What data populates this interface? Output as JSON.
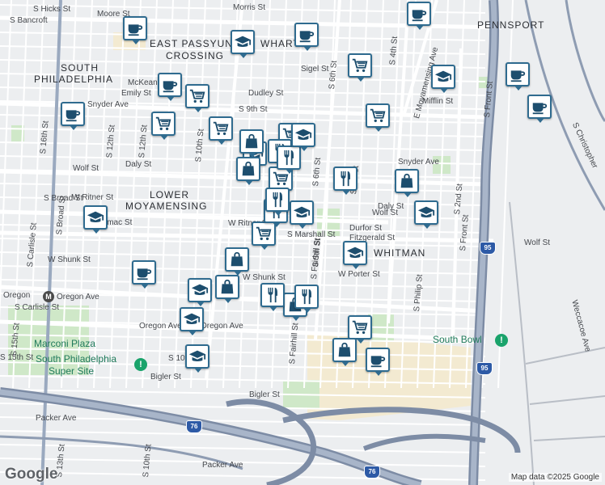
{
  "map": {
    "attribution": "Map data ©2025 Google",
    "logo": "Google",
    "area_labels": [
      "EAST PASSYUNK",
      "CROSSING",
      "SOUTH",
      "PHILADELPHIA",
      "LOWER",
      "MOYAMENSING",
      "WHITMAN",
      "PENNSPORT",
      "WHARTON"
    ],
    "poi_labels": [
      "Marconi Plaza",
      "South Philadelphia",
      "Super Site",
      "South Bowl",
      "Oregon"
    ],
    "streets": [
      "Morris St",
      "Moore St",
      "Sigel St",
      "McKean St",
      "Emily St",
      "Dudley St",
      "Snyder Ave",
      "Wolf St",
      "Daly St",
      "W Ritner St",
      "W Shunk St",
      "Oregon Ave",
      "W Porter St",
      "Bigler St",
      "Packer Ave",
      "Mifflin St",
      "Durfor St",
      "Fitzgerald St",
      "S 6th St",
      "S 4th St",
      "S 2nd St",
      "S Front St",
      "S 15th St",
      "S 16th St",
      "S Broad St",
      "S Carlisle St",
      "S 13th St",
      "S 12th St",
      "S 10th St",
      "S 9th St",
      "S 5th St",
      "S Philip St",
      "Weccacoe Ave",
      "E Moyamensing Ave",
      "S Christopher",
      "S Fairhill St",
      "S Marshall St",
      "S Camac St",
      "S Hicks St",
      "S Bancroft"
    ],
    "highway_shields": [
      "95",
      "76"
    ],
    "marker_types": [
      "coffee-icon",
      "school-icon",
      "shopping-cart-icon",
      "shopping-bag-icon",
      "restaurant-icon"
    ]
  }
}
